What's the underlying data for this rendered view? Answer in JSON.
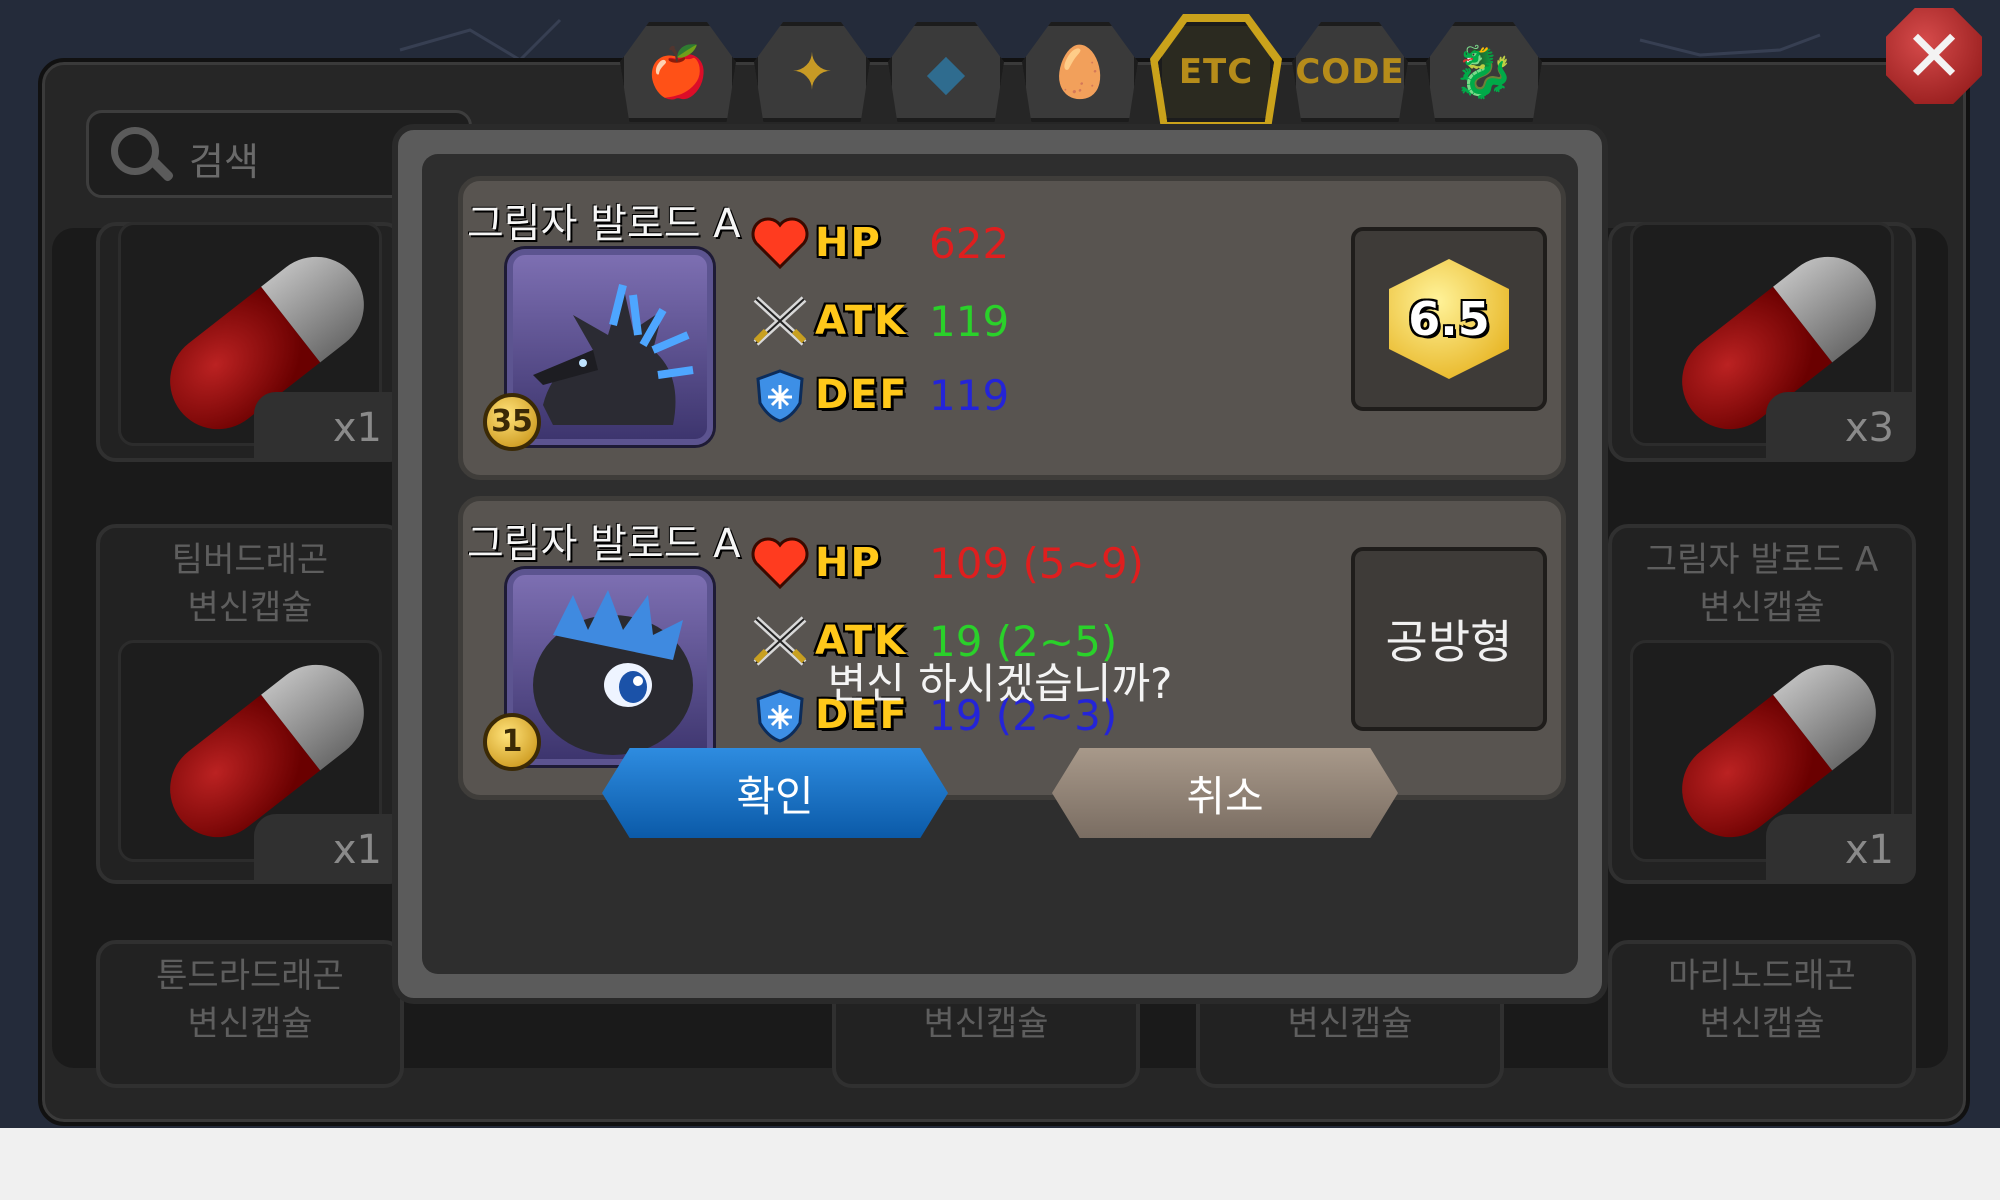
{
  "search": {
    "placeholder": "검색"
  },
  "tabs": [
    {
      "name": "food",
      "icon": "🍎"
    },
    {
      "name": "ore",
      "icon": "✦"
    },
    {
      "name": "egg-material",
      "icon": "◆"
    },
    {
      "name": "egg",
      "icon": "🥚"
    },
    {
      "name": "etc",
      "label": "ETC",
      "active": true
    },
    {
      "name": "code",
      "label": "CODE"
    },
    {
      "name": "dragon",
      "icon": "🐉"
    }
  ],
  "inventory": {
    "items": [
      {
        "name": "",
        "count": "x1"
      },
      {
        "name": "",
        "count": "x3"
      },
      {
        "name_line1": "팀버드래곤",
        "name_line2": "변신캡슐",
        "count": "x1"
      },
      {
        "name_line1": "그림자 발로드 A",
        "name_line2": "변신캡슐",
        "count": "x1"
      },
      {
        "name_line1": "툰드라드래곤",
        "name_line2": "변신캡슐"
      },
      {
        "name_line1": "",
        "name_line2": "변신캡슐"
      },
      {
        "name_line1": "",
        "name_line2": "변신캡슐"
      },
      {
        "name_line1": "마리노드래곤",
        "name_line2": "변신캡슐"
      }
    ]
  },
  "dialog": {
    "current": {
      "name": "그림자 발로드 A",
      "level": "35",
      "hp_label": "HP",
      "hp": "622",
      "atk_label": "ATK",
      "atk": "119",
      "def_label": "DEF",
      "def": "119",
      "grade": "6.5"
    },
    "transformed": {
      "name": "그림자 발로드 A",
      "level": "1",
      "hp_label": "HP",
      "hp": "109 (5~9)",
      "atk_label": "ATK",
      "atk": "19 (2~5)",
      "def_label": "DEF",
      "def": "19 (2~3)",
      "type": "공방형"
    },
    "question": "변신 하시겠습니까?",
    "confirm": "확인",
    "cancel": "취소"
  },
  "colors": {
    "hp": "#e01e1e",
    "atk": "#2ad12a",
    "def": "#2424d8",
    "stat_label": "#ffc81a",
    "confirm": "#0b5aa8",
    "cancel": "#7a6d62"
  }
}
